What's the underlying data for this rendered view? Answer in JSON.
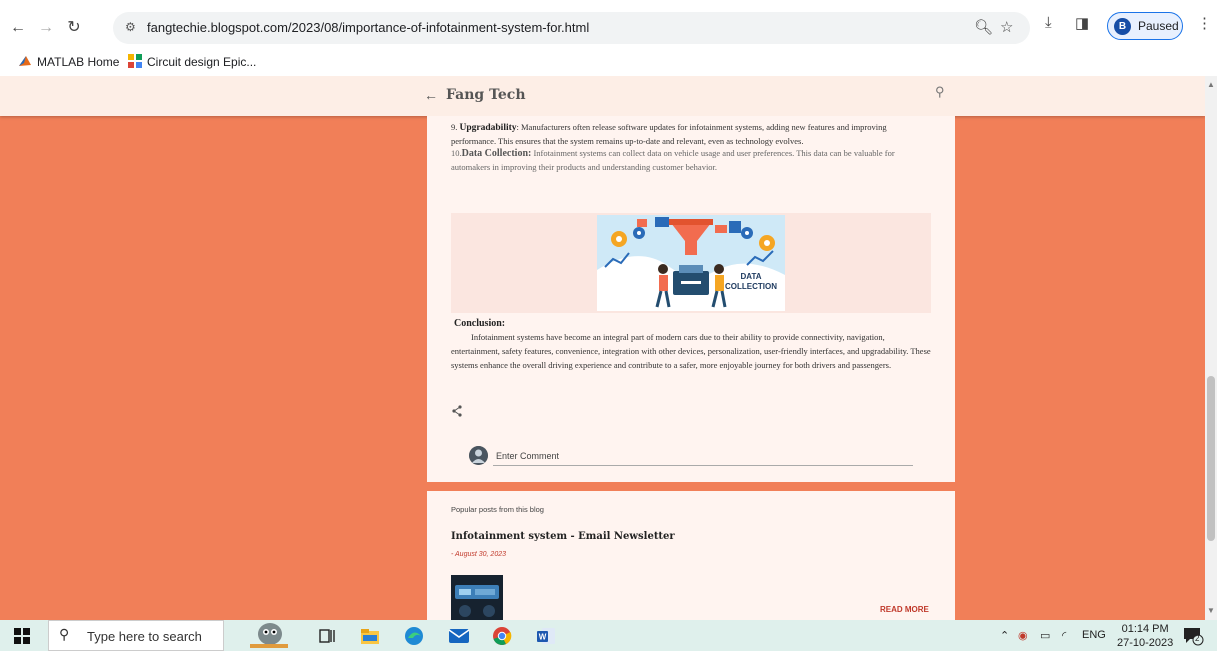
{
  "browser": {
    "url": "fangtechie.blogspot.com/2023/08/importance-of-infotainment-system-for.html",
    "profile_initial": "B",
    "profile_status": "Paused",
    "bookmarks": [
      "MATLAB Home",
      "Circuit design Epic..."
    ]
  },
  "blog": {
    "title": "Fang Tech",
    "item9_label": "9. ",
    "item9_title": "Upgradability",
    "item9_text": ": Manufacturers often release software updates for infotainment systems, adding new features and improving performance. This ensures that the system remains up-to-date and relevant, even as technology evolves.",
    "item10_label": "10.",
    "item10_title": "Data Collection:",
    "item10_text": " Infotainment systems can collect data on vehicle usage and user preferences. This data can be valuable for automakers in improving their products and understanding customer behavior.",
    "image_caption": "DATA COLLECTION",
    "image_caption_line1": "DATA",
    "image_caption_line2": "COLLECTION",
    "conclusion_heading": "Conclusion:",
    "conclusion_text": "Infotainment systems have become an integral part of modern cars due to their ability to provide connectivity, navigation, entertainment, safety features, convenience, integration with other devices, personalization, user-friendly interfaces, and upgradability. These systems enhance the overall driving experience and contribute to a safer, more enjoyable journey for both drivers and passengers.",
    "comment_placeholder": "Enter Comment"
  },
  "popular": {
    "label": "Popular posts from this blog",
    "post_title": "Infotainment system - Email Newsletter",
    "post_date": "- August 30, 2023",
    "read_more": "READ MORE"
  },
  "taskbar": {
    "search_placeholder": "Type here to search",
    "lang": "ENG",
    "time": "01:14 PM",
    "date": "27-10-2023",
    "notifications": "2"
  },
  "colors": {
    "page_bg": "#f17f58",
    "card_bg": "#fff4f0",
    "accent": "#c0392b"
  }
}
